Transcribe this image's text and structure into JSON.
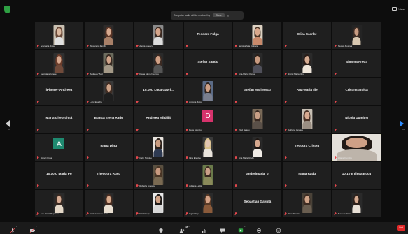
{
  "app": {
    "name": "Zoom Meeting"
  },
  "banner": {
    "text": "Computer audio will be enabled by",
    "button": "Close",
    "close_glyph": "×"
  },
  "view": {
    "label": "View"
  },
  "pager": {
    "current": "1/2",
    "next": "1/2"
  },
  "colors": {
    "grid_bg": "#0d0d0d",
    "tile_bg": "#1f1f1f",
    "active_border": "#c8d54a",
    "mute_red": "#e5484d",
    "end_red": "#e02828",
    "nav_blue": "#2d8cff"
  },
  "tiles": [
    {
      "name": "Anamaria Rusu",
      "kind": "photo",
      "palette": [
        "#c9c0b1",
        "#dbb9a0",
        "#6a4a3a",
        "#e0e0e0"
      ]
    },
    {
      "name": "Alexandra Zamfir",
      "kind": "photo",
      "palette": [
        "#2e2b2a",
        "#d6a98f",
        "#5a3526",
        "#a88068"
      ]
    },
    {
      "name": "Alexia Ionescu",
      "kind": "photo",
      "palette": [
        "#8a8a8a",
        "#d4a48a",
        "#3b2a22",
        "#ddd"
      ]
    },
    {
      "name": "Teodora Fulga",
      "kind": "text"
    },
    {
      "name": "Iasmina Mia Ciobanu",
      "kind": "photo",
      "palette": [
        "#dcd1c2",
        "#d9a88c",
        "#4a3426",
        "#c98a6b"
      ]
    },
    {
      "name": "Eliza Scarlat",
      "kind": "text"
    },
    {
      "name": "Alessia Bosnea",
      "kind": "photo",
      "palette": [
        "#242424",
        "#c89c82",
        "#3a2b24",
        "#d8c7b0"
      ]
    },
    {
      "name": "Georgiana Ionete",
      "kind": "photo",
      "palette": [
        "#303030",
        "#d6a88f",
        "#6b3c2a",
        "#704a3a"
      ]
    },
    {
      "name": "Andreea Vlad",
      "kind": "photo",
      "palette": [
        "#6c6c5e",
        "#cfa48a",
        "#3a2c24",
        "#a59a88"
      ]
    },
    {
      "name": "Diana Elena Neamțu",
      "kind": "photo",
      "palette": [
        "#2a2a2a",
        "#d1a085",
        "#3c2a22",
        "#555"
      ]
    },
    {
      "name": "Stefan Sandu",
      "kind": "text"
    },
    {
      "name": "Ana-Maria Oprea",
      "kind": "photo",
      "palette": [
        "#2a2a2a",
        "#c99b80",
        "#2c2019",
        "#50505a"
      ]
    },
    {
      "name": "Ingrid Maria Dinu",
      "kind": "photo",
      "palette": [
        "#2a2a2a",
        "#d6ac92",
        "#2a1d18",
        "#efe6da"
      ]
    },
    {
      "name": "Simona Preda",
      "kind": "text"
    },
    {
      "name": "iPhone - Andreea",
      "kind": "text"
    },
    {
      "name": "Luca Enache",
      "kind": "photo",
      "palette": [
        "#3a3a3a",
        "#cda287",
        "#3f2d24",
        "#1e1e1e"
      ]
    },
    {
      "name": "10.10C Luca Gavri...",
      "kind": "text"
    },
    {
      "name": "Antonia Bucur",
      "kind": "photo",
      "palette": [
        "#5b6b86",
        "#cfa085",
        "#2f2520",
        "#7a7f8f"
      ]
    },
    {
      "name": "Stefan Marinescu",
      "kind": "text"
    },
    {
      "name": "Ana-Maria Ilie",
      "kind": "text"
    },
    {
      "name": "Cristina Stoica",
      "kind": "text"
    },
    {
      "name": "Maria Gheorghiță",
      "kind": "text"
    },
    {
      "name": "Bianca Elena Radu",
      "kind": "text"
    },
    {
      "name": "Andreea Mihăilă",
      "kind": "text"
    },
    {
      "name": "Delia Stanciu",
      "kind": "letter",
      "letter": "D",
      "color": "#d6336c"
    },
    {
      "name": "Vlad Neagu",
      "kind": "photo",
      "palette": [
        "#7a6a58",
        "#caa086",
        "#3a2a22",
        "#5a5048"
      ]
    },
    {
      "name": "Adriana Ionescu",
      "kind": "photo",
      "palette": [
        "#c8c0b4",
        "#d8aa90",
        "#4a3226",
        "#9a8e82"
      ]
    },
    {
      "name": "Nicola Dumitru",
      "kind": "text"
    },
    {
      "name": "Robert Popa",
      "kind": "letter",
      "letter": "A",
      "color": "#1f8a70"
    },
    {
      "name": "Ioana Dinu",
      "kind": "text"
    },
    {
      "name": "Calin Nicolae",
      "kind": "photo",
      "palette": [
        "#e8e4de",
        "#c99c80",
        "#2c221c",
        "#2e3a52"
      ]
    },
    {
      "name": "Irina Enache",
      "kind": "photo",
      "palette": [
        "#3a3a3a",
        "#e2c6b2",
        "#d9c08a",
        "#e9e4dc"
      ]
    },
    {
      "name": "Ana Maria Radu",
      "kind": "photo",
      "palette": [
        "#2a2a2a",
        "#d6a88e",
        "#1e1612",
        "#f0ece6"
      ]
    },
    {
      "name": "Teodora Cristea",
      "kind": "text"
    },
    {
      "name": "Iuliana Dumitru",
      "kind": "photo",
      "wide": true,
      "active": true,
      "palette": [
        "#e4e0da",
        "#cfa086",
        "#221a16",
        "#bdb4aa"
      ]
    },
    {
      "name": "10.10 C Maria Po",
      "kind": "text"
    },
    {
      "name": "Theodora Rusu",
      "kind": "text"
    },
    {
      "name": "Roberta Ionescu",
      "kind": "photo",
      "palette": [
        "#5a5040",
        "#c89a80",
        "#4a3626",
        "#7a6a52"
      ]
    },
    {
      "name": "Adriana Lazăr",
      "kind": "photo",
      "palette": [
        "#6a7a4a",
        "#caa088",
        "#3a2a20",
        "#8a8a5a"
      ]
    },
    {
      "name": "andreimaria_b",
      "kind": "text"
    },
    {
      "name": "Ioana Radu",
      "kind": "text"
    },
    {
      "name": "10.10 E Ilinca Bucu",
      "kind": "text"
    },
    {
      "name": "Ana-Maria Popescu",
      "kind": "photo",
      "palette": [
        "#2a2a2a",
        "#d6ac94",
        "#3a2a22",
        "#e4d8c8"
      ]
    },
    {
      "name": "Carla Ionescu Alexe",
      "kind": "photo",
      "palette": [
        "#2a2a2a",
        "#d8aa8c",
        "#4a2e22",
        "#e8ded0"
      ]
    },
    {
      "name": "Eric Neagu",
      "kind": "photo",
      "palette": [
        "#e8e8e8",
        "#d0a286",
        "#1e1a18",
        "#d8d8d8"
      ]
    },
    {
      "name": "Ingrid Pop",
      "kind": "photo",
      "palette": [
        "#2a2a2a",
        "#d4a286",
        "#5a3a26",
        "#8a5a3a"
      ]
    },
    {
      "name": "Sebastian Gavrilă",
      "kind": "text"
    },
    {
      "name": "Irina Stanciu",
      "kind": "photo",
      "palette": [
        "#4a4238",
        "#d0a488",
        "#3e2c22",
        "#6a5e50"
      ]
    },
    {
      "name": "Teodora Pavel",
      "kind": "photo",
      "palette": [
        "#2a2a2a",
        "#d6ac92",
        "#2e221c",
        "#e8e0d6"
      ]
    }
  ],
  "toolbar": {
    "items": [
      {
        "name": "unmute"
      },
      {
        "name": "start-video"
      },
      {
        "name": "security"
      },
      {
        "name": "participants",
        "count": "48"
      },
      {
        "name": "polls"
      },
      {
        "name": "chat"
      },
      {
        "name": "share-screen"
      },
      {
        "name": "record"
      },
      {
        "name": "reactions"
      }
    ],
    "end_label": "End"
  }
}
